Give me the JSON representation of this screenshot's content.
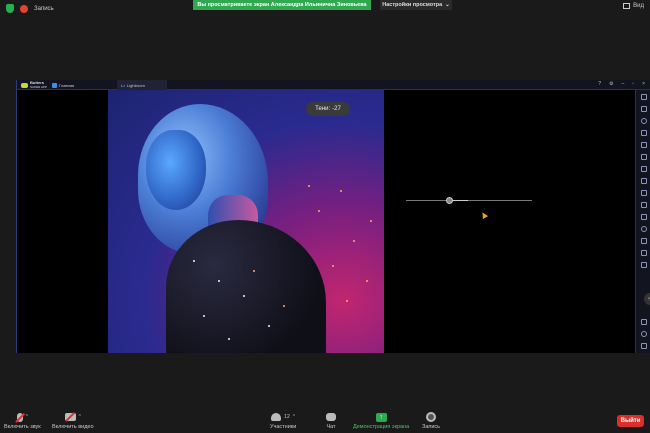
{
  "topbar": {
    "recording_label": "Запись",
    "banner_text": "Вы просматриваете экран Александра Ильинична Зиновьева",
    "view_options_label": "Настройки просмотра",
    "view_label": "Вид"
  },
  "shared_window": {
    "logo_line1": "Butters",
    "logo_line2": "SUPER APP",
    "tab1_label": "Главная",
    "tab2_label": "Lightroom",
    "tab2_icon": "Lr"
  },
  "editor": {
    "tooltip_label": "Тени:",
    "tooltip_value": "-27",
    "slider_level": 0.45
  },
  "toolbar": {
    "unmute_label": "Включить звук",
    "start_video_label": "Включить видео",
    "participants_label": "Участники",
    "participants_count": "12",
    "chat_label": "Чат",
    "share_label": "Демонстрация экрана",
    "record_label": "Запись",
    "leave_label": "Выйти"
  },
  "colors": {
    "banner": "#2fa84f",
    "leave": "#d9302c",
    "accent": "#4ec26b"
  }
}
